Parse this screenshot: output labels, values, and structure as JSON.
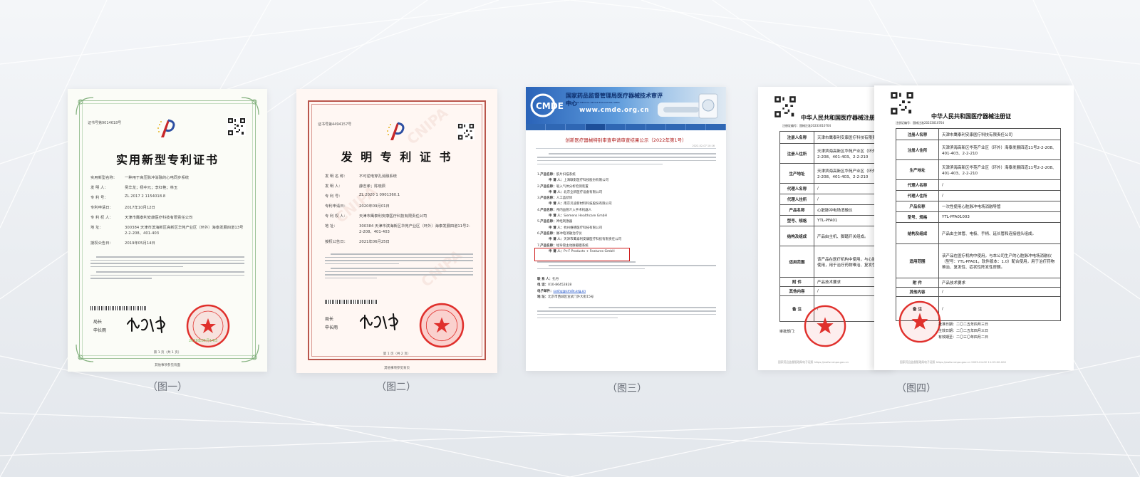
{
  "captions": [
    "（图一）",
    "（图二）",
    "（图三）",
    "（图四）"
  ],
  "cert1": {
    "serial": "证书号第9014618号",
    "title": "实用新型专利证书",
    "fields": [
      {
        "k": "实用新型名称：",
        "v": "一种用于高压脉冲消融的心电同步系统"
      },
      {
        "k": "发 明 人：",
        "v": "吴华龙；杨中元；李红艳；林玉"
      },
      {
        "k": "专 利 号：",
        "v": "ZL 2017 2 1154018.8"
      },
      {
        "k": "专利申请日：",
        "v": "2017年10月12日"
      },
      {
        "k": "专 利 权 人：",
        "v": "天津市鹰泰利安康医疗科技有限责任公司"
      },
      {
        "k": "地 址：",
        "v": "300384 天津市滨海新区高新区华苑产业区（环外）海泰发展四道13号2-2-208、401-403"
      },
      {
        "k": "授权公告日：",
        "v": "2019年05月14日"
      }
    ],
    "sign_label_1": "局长",
    "sign_label_2": "申长雨",
    "seal_date": "2019年05月14日",
    "page": "第 1 页（共 1 页）",
    "footer": "其他事项参见背面"
  },
  "cert2": {
    "serial": "证书号第4494157号",
    "title": "发 明 专 利 证 书",
    "fields": [
      {
        "k": "发 明 名 称：",
        "v": "不可逆电穿孔消融系统"
      },
      {
        "k": "发 明 人：",
        "v": "薛志孝；陈晓辰"
      },
      {
        "k": "专 利 号：",
        "v": "ZL 2020 1 0901360.1"
      },
      {
        "k": "专利申请日：",
        "v": "2020年09月01日"
      },
      {
        "k": "专 利 权 人：",
        "v": "天津市鹰泰利安康医疗科技有限责任公司"
      },
      {
        "k": "地 址：",
        "v": "300384 天津市滨海新区华苑产业区（环外）海泰发展四道11号2-2-208、401-403"
      },
      {
        "k": "授权公告日：",
        "v": "2021年06月25日"
      }
    ],
    "sign_label_1": "局长",
    "sign_label_2": "申长雨",
    "page": "第 1 页（共 2 页）",
    "footer": "其他事项参见背页",
    "watermark": "CNIPA"
  },
  "cmde": {
    "org": "国家药品监督管理局医疗器械技术审评中心",
    "org_en": "CENTER FOR MEDICAL DEVICE EVALUATION, NMPA",
    "logo": "CMDE",
    "url": "www.cmde.org.cn",
    "title": "创新医疗器械特别审查申请审查结果公示（2022年第1号）",
    "date": "2022-02-07 10:16",
    "items": [
      {
        "n": "1.",
        "prod": "胶片扫描系统",
        "co": "上海联影医疗科技股份有限公司"
      },
      {
        "n": "2.",
        "prod": "吸入气体分析检测装置",
        "co": "北京全新医疗设备有限公司"
      },
      {
        "n": "3.",
        "prod": "人工晶状体",
        "co": "南京贝迪新材料科技股份有限公司"
      },
      {
        "n": "4.",
        "prod": "颅内血管介入手术机器人",
        "co": "Siemens Healthcare GmbH"
      },
      {
        "n": "5.",
        "prod": "神经刺激器",
        "co": "杭州维德医疗科技有限公司"
      },
      {
        "n": "6.",
        "prod": "脉冲电消融治疗仪",
        "co": "天津市鹰泰利安康医疗科技有限责任公司"
      },
      {
        "n": "7.",
        "prod": "经导管主动脉瓣膜系统",
        "co": "P+F Products + Features GmbH"
      }
    ],
    "k_prod": "产品名称：",
    "k_co": "申 请 人：",
    "k_cont": "联 系 人：",
    "cont_v": "孔丹",
    "k_tel": "电 话：",
    "tel_v": "010-86452828",
    "k_mail": "电子邮件：",
    "mail_v": "cxshy@cmde.org.cn",
    "k_addr": "地 址：",
    "addr_v": "北京市西城区宣武门外大街15号"
  },
  "reg": {
    "title": "中华人民共和国医疗器械注册证",
    "reg_no": "注册证编号：国械注准20233010704",
    "fields_a": [
      {
        "k": "注册人名称",
        "v": "天津市鹰泰利安康医疗科技有限责任公司"
      },
      {
        "k": "注册人住所",
        "v": "天津滨海高新区华苑产业区（环外）海泰发展四道11号2-2-208、401-403、2-2-210"
      },
      {
        "k": "生产地址",
        "v": "天津滨海高新区华苑产业区（环外）海泰发展四道11号2-2-208、401-403、2-2-210"
      },
      {
        "k": "代理人名称",
        "v": "/"
      },
      {
        "k": "代理人住所",
        "v": "/"
      },
      {
        "k": "产品名称",
        "v": "心脏脉冲电场消融仪"
      },
      {
        "k": "型号、规格",
        "v": "YTL-PFA01"
      },
      {
        "k": "结构及组成",
        "v": "产品由主机、脚踏开关组成。"
      },
      {
        "k": "适用范围",
        "v": "该产品在医疗机构中使用，与心脏脉冲电场消融导管配合使用，用于治疗药物难治、复发性、症状性阵发性房颤。"
      },
      {
        "k": "附 件",
        "v": "产品技术要求"
      },
      {
        "k": "其他内容",
        "v": "/"
      },
      {
        "k": "备 注",
        "v": "/"
      }
    ],
    "fields_b": [
      {
        "k": "注册人名称",
        "v": "天津市鹰泰利安康医疗科技有限责任公司"
      },
      {
        "k": "注册人住所",
        "v": "天津滨海高新区华苑产业区（环外）海泰发展四道11号2-2-208、401-403、2-2-210"
      },
      {
        "k": "生产地址",
        "v": "天津滨海高新区华苑产业区（环外）海泰发展四道11号2-2-208、401-403、2-2-210"
      },
      {
        "k": "代理人名称",
        "v": "/"
      },
      {
        "k": "代理人住所",
        "v": "/"
      },
      {
        "k": "产品名称",
        "v": "一次性使用心脏脉冲电场消融导管"
      },
      {
        "k": "型号、规格",
        "v": "YTL-PFA01003"
      },
      {
        "k": "结构及组成",
        "v": "产品由主体管、电极、手柄、延长管和连接插头组成。"
      },
      {
        "k": "适用范围",
        "v": "该产品在医疗机构中使用，与本公司生产的心脏脉冲电场消融仪（型号：YTL-PFA01，软件版本：1.0）配合使用，用于治疗药物难治、复发性、症状性阵发性房颤。"
      },
      {
        "k": "附 件",
        "v": "产品技术要求"
      },
      {
        "k": "其他内容",
        "v": "/"
      },
      {
        "k": "备 注",
        "v": "/"
      }
    ],
    "review_label": "审批部门：",
    "issue_date": "批准日期：二〇二五年四月三日",
    "effective_date": "生效日期：二〇二五年四月三日",
    "expiry_date": "有效期至：二〇三〇年四月二日",
    "foot_a": "国家药品监督管理局电子证照 https://zwfw.nmpa.gov.cn",
    "foot_b": "国家药品监督管理局电子证照 https://zwfw.nmpa.gov.cn 2025-04-02 11:03:00.000",
    "seal_text": "国家药品监督管理局"
  }
}
